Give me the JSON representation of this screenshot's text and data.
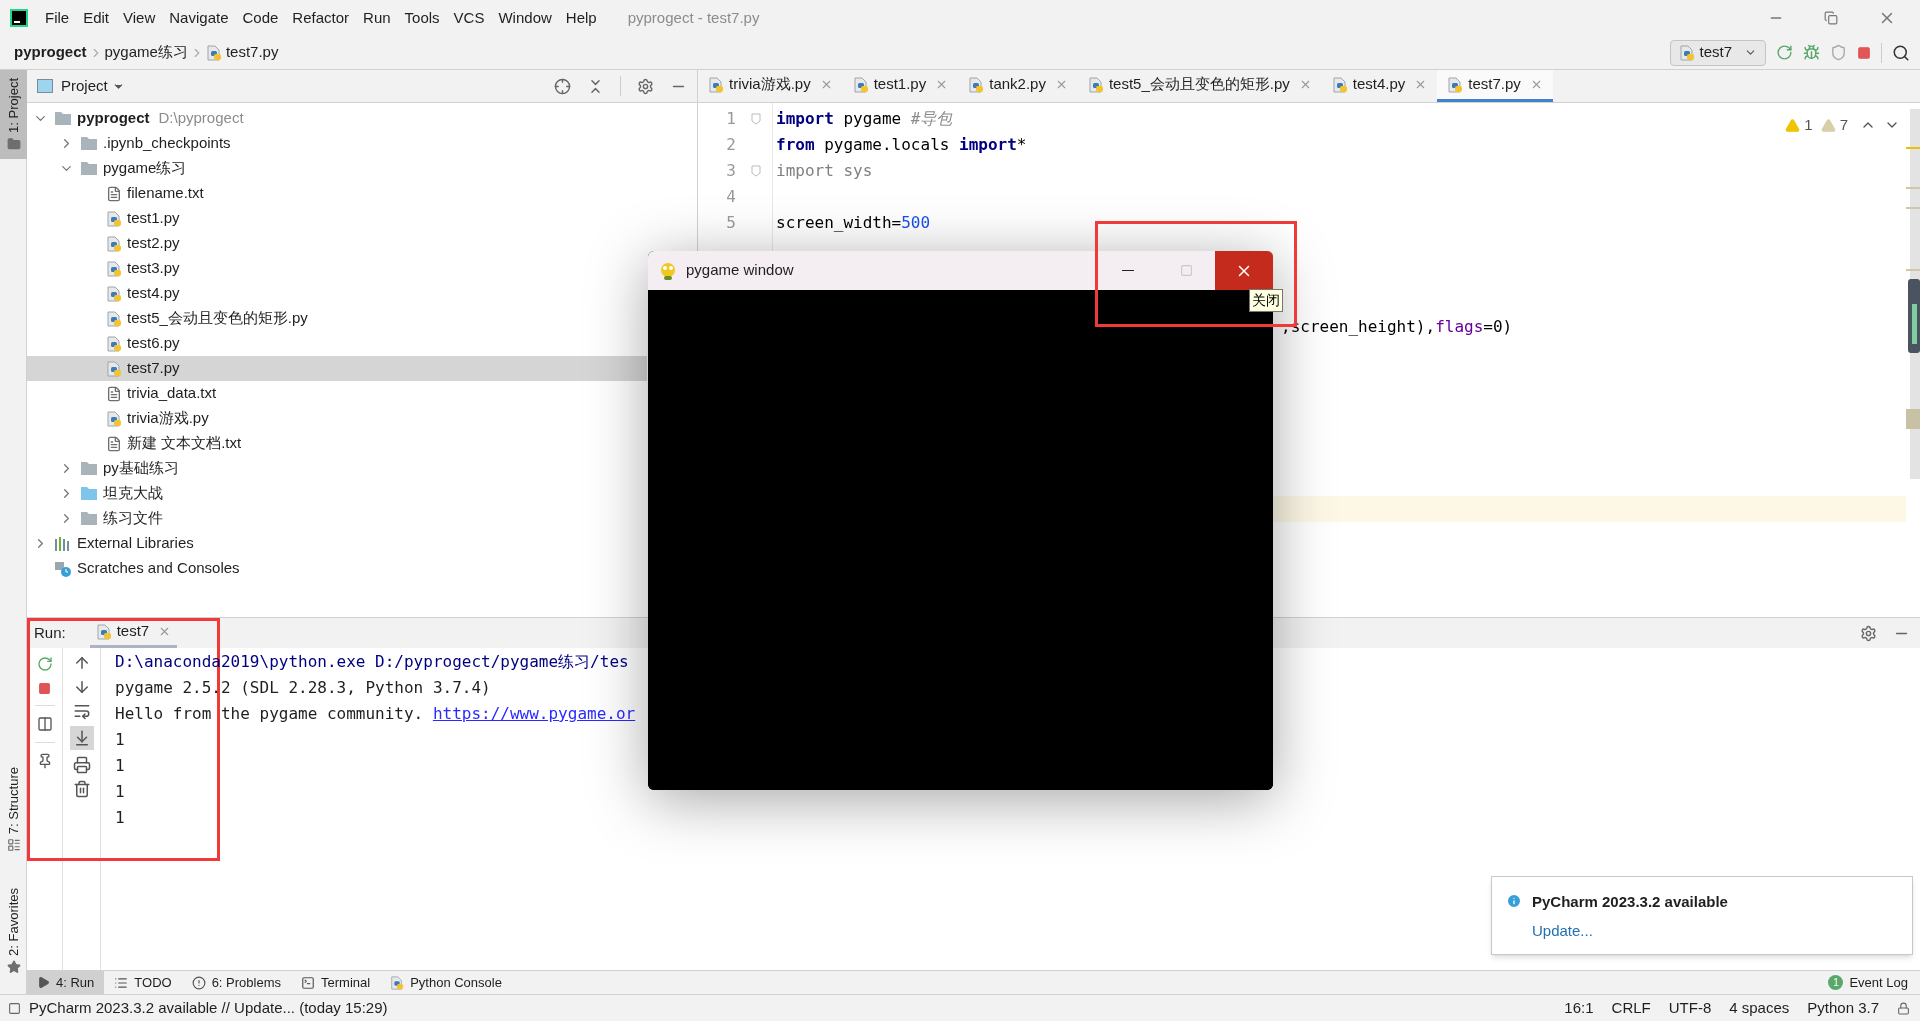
{
  "title_bar": {
    "menu": [
      "File",
      "Edit",
      "View",
      "Navigate",
      "Code",
      "Refactor",
      "Run",
      "Tools",
      "VCS",
      "Window",
      "Help"
    ],
    "title": "pyprogect - test7.py"
  },
  "nav_bar": {
    "breadcrumbs": [
      "pyprogect",
      "pygame练习",
      "test7.py"
    ],
    "run_config": "test7"
  },
  "left_stripe": {
    "top": [
      {
        "label": "1: Project",
        "kind": "project",
        "selected": true
      }
    ],
    "bottom": [
      {
        "label": "7: Structure",
        "kind": "structure",
        "selected": false
      },
      {
        "label": "2: Favorites",
        "kind": "favorites",
        "selected": false
      }
    ]
  },
  "project_panel": {
    "title": "Project",
    "tree": [
      {
        "label": "pyprogect",
        "path": "D:\\pyprogect",
        "kind": "folder",
        "expanded": true,
        "selected": false,
        "children": [
          {
            "label": ".ipynb_checkpoints",
            "kind": "folder",
            "expanded": false,
            "selected": false
          },
          {
            "label": "pygame练习",
            "kind": "folder",
            "expanded": true,
            "selected": false,
            "children": [
              {
                "label": "filename.txt",
                "kind": "text_file",
                "selected": false
              },
              {
                "label": "test1.py",
                "kind": "python_file",
                "selected": false
              },
              {
                "label": "test2.py",
                "kind": "python_file",
                "selected": false
              },
              {
                "label": "test3.py",
                "kind": "python_file",
                "selected": false
              },
              {
                "label": "test4.py",
                "kind": "python_file",
                "selected": false
              },
              {
                "label": "test5_会动且变色的矩形.py",
                "kind": "python_file",
                "selected": false
              },
              {
                "label": "test6.py",
                "kind": "python_file",
                "selected": false
              },
              {
                "label": "test7.py",
                "kind": "python_file",
                "selected": true
              },
              {
                "label": "trivia_data.txt",
                "kind": "text_file",
                "selected": false
              },
              {
                "label": "trivia游戏.py",
                "kind": "python_file",
                "selected": false
              },
              {
                "label": "新建 文本文档.txt",
                "kind": "text_file",
                "selected": false
              }
            ]
          },
          {
            "label": "py基础练习",
            "kind": "folder",
            "expanded": false,
            "selected": false
          },
          {
            "label": "坦克大战",
            "kind": "source_folder",
            "expanded": false,
            "selected": false
          },
          {
            "label": "练习文件",
            "kind": "folder",
            "expanded": false,
            "selected": false
          }
        ]
      },
      {
        "label": "External Libraries",
        "kind": "libraries",
        "expanded": false,
        "selected": false
      },
      {
        "label": "Scratches and Consoles",
        "kind": "scratches",
        "selected": false
      }
    ]
  },
  "editor": {
    "tabs": [
      {
        "label": "trivia游戏.py",
        "selected": false
      },
      {
        "label": "test1.py",
        "selected": false
      },
      {
        "label": "tank2.py",
        "selected": false
      },
      {
        "label": "test5_会动且变色的矩形.py",
        "selected": false
      },
      {
        "label": "test4.py",
        "selected": false
      },
      {
        "label": "test7.py",
        "selected": true
      }
    ],
    "warnings": [
      {
        "count": "1",
        "kind": "warning"
      },
      {
        "count": "7",
        "kind": "weak_warning"
      }
    ],
    "lines": [
      {
        "number": "1",
        "fold": true,
        "tokens": [
          {
            "text": "import",
            "kind": "keyword"
          },
          {
            "text": " pygame ",
            "kind": "plain"
          },
          {
            "text": "#导包",
            "kind": "comment"
          }
        ]
      },
      {
        "number": "2",
        "fold": false,
        "tokens": [
          {
            "text": "from",
            "kind": "keyword"
          },
          {
            "text": " pygame.locals ",
            "kind": "plain"
          },
          {
            "text": "import",
            "kind": "keyword"
          },
          {
            "text": "*",
            "kind": "plain"
          }
        ]
      },
      {
        "number": "3",
        "fold": true,
        "tokens": [
          {
            "text": "import sys",
            "kind": "unused"
          }
        ]
      },
      {
        "number": "4",
        "fold": false
      },
      {
        "number": "5",
        "fold": false,
        "tokens": [
          {
            "text": "screen_width=",
            "kind": "plain"
          },
          {
            "text": "500",
            "kind": "number"
          }
        ]
      }
    ],
    "partial_line": [
      {
        "text": ",screen_height),",
        "kind": "plain"
      },
      {
        "text": "flags",
        "kind": "param"
      },
      {
        "text": "=0)",
        "kind": "plain"
      }
    ]
  },
  "run_panel": {
    "label": "Run:",
    "tab": "test7",
    "scroll_to_end_on": true,
    "lines": [
      {
        "kind": "command",
        "text": "D:\\anaconda2019\\python.exe D:/pyprogect/pygame练习/tes"
      },
      {
        "kind": "output",
        "text": "pygame 2.5.2 (SDL 2.28.3, Python 3.7.4)"
      },
      {
        "kind": "output",
        "text": "Hello from the pygame community. ",
        "link": "https://www.pygame.or"
      },
      {
        "kind": "output",
        "text": "1"
      },
      {
        "kind": "output",
        "text": "1"
      },
      {
        "kind": "output",
        "text": "1"
      },
      {
        "kind": "output",
        "text": "1"
      }
    ]
  },
  "pygame_window": {
    "title": "pygame window",
    "tooltip": "关闭",
    "maximize_disabled": true
  },
  "notification": {
    "title": "PyCharm 2023.3.2 available",
    "link": "Update..."
  },
  "tool_bar": {
    "tools": [
      {
        "label": "4: Run",
        "kind": "run",
        "selected": true
      },
      {
        "label": "TODO",
        "kind": "todo",
        "selected": false
      },
      {
        "label": "6: Problems",
        "kind": "problems",
        "selected": false
      },
      {
        "label": "Terminal",
        "kind": "terminal",
        "selected": false
      },
      {
        "label": "Python Console",
        "kind": "console",
        "selected": false
      }
    ],
    "event_log": {
      "label": "Event Log",
      "count": "1"
    }
  },
  "status_bar": {
    "message": "PyCharm 2023.3.2 available // Update... (today 15:29)",
    "items": [
      "16:1",
      "CRLF",
      "UTF-8",
      "4 spaces",
      "Python 3.7"
    ]
  }
}
